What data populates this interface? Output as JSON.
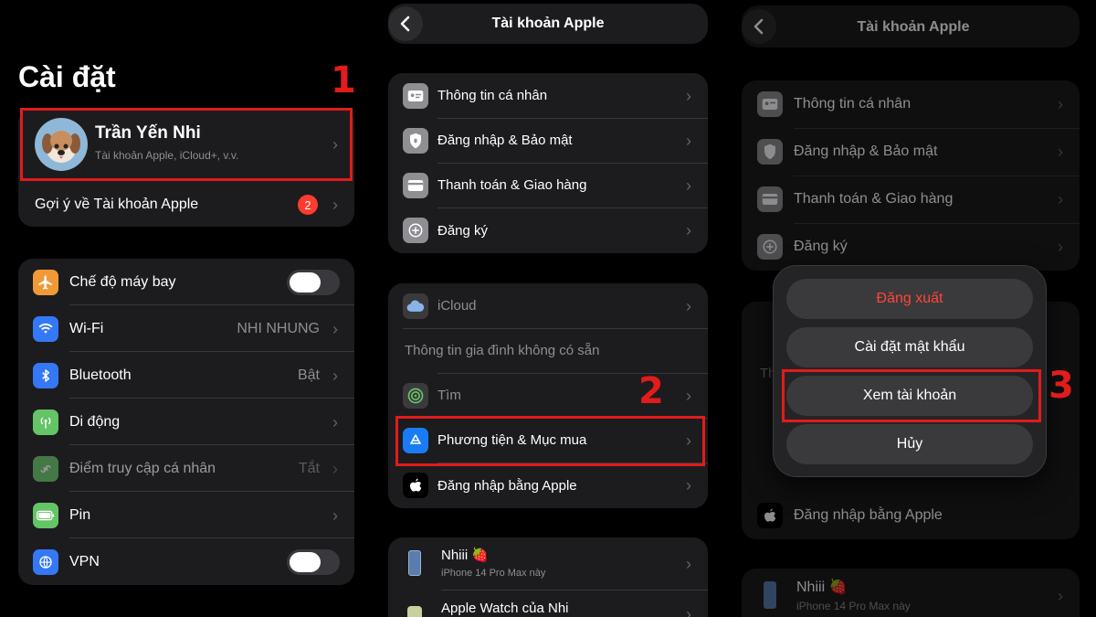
{
  "panel1": {
    "title": "Cài đặt",
    "profile": {
      "name": "Trần Yến Nhi",
      "subtitle": "Tài khoản Apple, iCloud+, v.v."
    },
    "suggestion": {
      "label": "Gợi ý về Tài khoản Apple",
      "badge": "2"
    },
    "settings": [
      {
        "label": "Chế độ máy bay",
        "value": "",
        "icon": "airplane-icon",
        "color": "#f09a37"
      },
      {
        "label": "Wi-Fi",
        "value": "NHI NHUNG",
        "icon": "wifi-icon",
        "color": "#3478f6"
      },
      {
        "label": "Bluetooth",
        "value": "Bật",
        "icon": "bluetooth-icon",
        "color": "#3478f6"
      },
      {
        "label": "Di động",
        "value": "",
        "icon": "cellular-icon",
        "color": "#65c466"
      },
      {
        "label": "Điểm truy cập cá nhân",
        "value": "Tắt",
        "icon": "hotspot-icon",
        "color": "#65c466"
      },
      {
        "label": "Pin",
        "value": "",
        "icon": "battery-icon",
        "color": "#65c466"
      },
      {
        "label": "VPN",
        "value": "",
        "icon": "vpn-icon",
        "color": "#3478f6"
      }
    ],
    "step": "1"
  },
  "panel2": {
    "title": "Tài khoản Apple",
    "group1": [
      "Thông tin cá nhân",
      "Đăng nhập & Bảo mật",
      "Thanh toán & Giao hàng",
      "Đăng ký"
    ],
    "group2": [
      "iCloud",
      "Thông tin gia đình không có sẵn",
      "Tìm",
      "Phương tiện & Mục mua",
      "Đăng nhập bằng Apple"
    ],
    "devices": [
      {
        "name": "Nhiii 🍓",
        "model": "iPhone 14 Pro Max này"
      },
      {
        "name": "Apple Watch của Nhi",
        "model": ""
      }
    ],
    "step": "2"
  },
  "panel3": {
    "title": "Tài khoản Apple",
    "group1": [
      "Thông tin cá nhân",
      "Đăng nhập & Bảo mật",
      "Thanh toán & Giao hàng",
      "Đăng ký"
    ],
    "bottom_item": "Đăng nhập bằng Apple",
    "partial_letter": "Th",
    "device": {
      "name": "Nhiii 🍓",
      "model": "iPhone 14 Pro Max này"
    },
    "sheet": {
      "logout": "Đăng xuất",
      "password": "Cài đặt mật khẩu",
      "view_account": "Xem tài khoản",
      "cancel": "Hủy"
    },
    "step": "3"
  },
  "colors": {
    "accent_red": "#e21b1b",
    "destructive": "#ff453a",
    "card_bg": "#1c1c1e"
  }
}
